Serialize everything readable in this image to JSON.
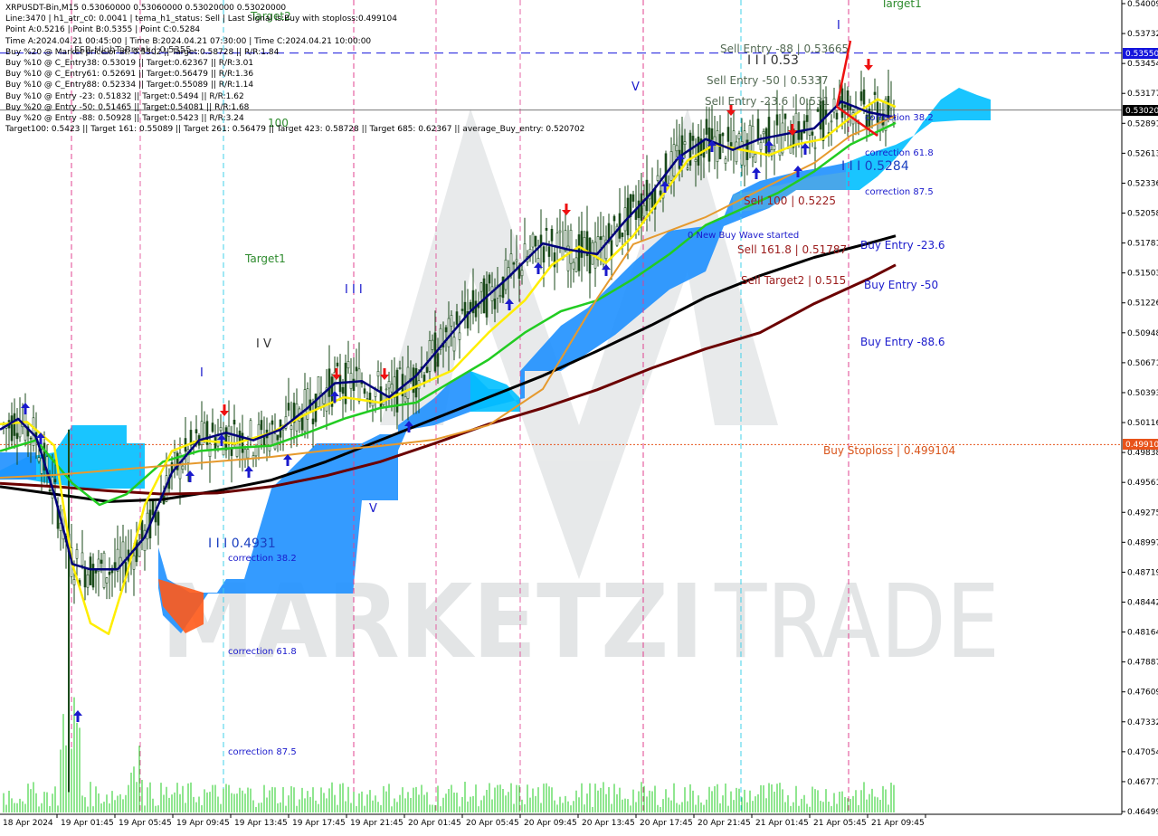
{
  "info_lines": [
    "XRPUSDT-Bin,M15  0.53060000 0.53060000 0.53020000 0.53020000",
    "Line:3470 | h1_atr_c0: 0.0041 | tema_h1_status: Sell | Last Signal is:Buy with stoploss:0.499104",
    "Point A:0.5216 | Point B:0.5355 | Point C:0.5284",
    "Time A:2024.04.21 00:45:00 | Time B:2024.04.21 07:30:00 | Time C:2024.04.21 10:00:00",
    "Buy %20 @ Market price or at: 0.5302 || Target:0.58728 || R/R:1.84",
    "Buy %10 @ C_Entry38: 0.53019 || Target:0.62367 || R/R:3.01",
    "Buy %10 @ C_Entry61: 0.52691 || Target:0.56479 || R/R:1.36",
    "Buy %10 @ C_Entry88: 0.52334 || Target:0.55089 || R/R:1.14",
    "Buy %10 @ Entry -23: 0.51832 || Target:0.5494 || R/R:1.62",
    "Buy %20 @ Entry -50: 0.51465 || Target:0.54081 || R/R:1.68",
    "Buy %20 @ Entry -88: 0.50928 || Target:0.5423 || R/R:3.24",
    "Target100: 0.5423 || Target 161: 0.55089 || Target 261: 0.56479 || Target 423: 0.58728 || Target 685: 0.62367 || average_Buy_entry: 0.520702"
  ],
  "watermark": {
    "brand_bold": "MARKETZI",
    "brand_light": "TRADE"
  },
  "price_labels": {
    "current": "0.53020",
    "blue_line": "0.53550",
    "stoploss": "0.49910"
  },
  "annotations": {
    "sell_entry_88": "Sell Entry -88 | 0.53665",
    "sell_entry_50": "Sell Entry -50 | 0.5337",
    "sell_entry_23": "Sell Entry -23.6 | 0.531",
    "sell_100": "Sell 100 | 0.5225",
    "sell_161": "Sell 161.8 | 0.51787",
    "sell_target2": "Sell Target2 | 0.515",
    "buy_entry_23": "Buy Entry -23.6",
    "buy_entry_50": "Buy Entry -50",
    "buy_entry_88": "Buy Entry -88.6",
    "buy_stoploss": "Buy Stoploss | 0.499104",
    "corr_38_right": "correction 38.2",
    "corr_61_right": "correction 61.8",
    "corr_87_right": "correction 87.5",
    "corr_38_left": "correction 38.2",
    "corr_61_left": "correction 61.8",
    "corr_87_left": "correction 87.5",
    "point_c_label": "I I I 0.5284",
    "point_b_label": "I I I 0.53",
    "low_label": "I I I 0.4931",
    "new_wave": "0 New Buy Wave started",
    "fsb_label": "FSB-HighToBreak | 0.5355",
    "target1_left": "Target1",
    "target2_left": "Target2",
    "target1_right": "Target1",
    "label_100": "100",
    "wave_V_left": "V",
    "wave_IV": "I V",
    "wave_III": "I I I",
    "wave_I": "I",
    "wave_V_top": "V",
    "wave_I_top": "I"
  },
  "colors": {
    "ema_black": "#000000",
    "ema_darkred": "#6b0000",
    "ma_green": "#22cc22",
    "ma_yellow": "#ffee00",
    "ma_navy": "#00007a",
    "ma_orange": "#e69a2e",
    "cloud_blue": "#1e90ff",
    "cloud_light": "#00bfff",
    "cloud_orange": "#ff5a1a",
    "vline_pink": "#e0408f",
    "vline_cyan": "#40d0e8",
    "candle": "#1a4a1a",
    "volume": "#22cc22"
  },
  "chart_data": {
    "type": "line",
    "title": "XRPUSDT-Bin,M15",
    "ylim": [
      0.46499,
      0.54009
    ],
    "y_ticks": [
      "0.54009",
      "0.53732",
      "0.53454",
      "0.53177",
      "0.52891",
      "0.52613",
      "0.52336",
      "0.52058",
      "0.51781",
      "0.51503",
      "0.51226",
      "0.50948",
      "0.50671",
      "0.50393",
      "0.50116",
      "0.49838",
      "0.49561",
      "0.49275",
      "0.48997",
      "0.48719",
      "0.48442",
      "0.48164",
      "0.47887",
      "0.47609",
      "0.47332",
      "0.47054",
      "0.46777",
      "0.46499"
    ],
    "x_ticks": [
      "18 Apr 2024",
      "19 Apr 01:45",
      "19 Apr 05:45",
      "19 Apr 09:45",
      "19 Apr 13:45",
      "19 Apr 17:45",
      "19 Apr 21:45",
      "20 Apr 01:45",
      "20 Apr 05:45",
      "20 Apr 09:45",
      "20 Apr 13:45",
      "20 Apr 17:45",
      "20 Apr 21:45",
      "21 Apr 01:45",
      "21 Apr 05:45",
      "21 Apr 09:45"
    ],
    "levels": {
      "current_price": 0.5302,
      "fsb_high": 0.5355,
      "buy_stoploss": 0.499104
    },
    "series": [
      {
        "color": "#000000",
        "x": [
          0,
          60,
          120,
          180,
          240,
          300,
          360,
          420,
          480,
          540,
          600,
          660,
          720,
          780,
          840,
          900,
          960,
          990
        ],
        "y": [
          0.4952,
          0.4945,
          0.4938,
          0.494,
          0.4948,
          0.4958,
          0.4975,
          0.4995,
          0.5015,
          0.5035,
          0.5055,
          0.5078,
          0.5102,
          0.5128,
          0.5148,
          0.5165,
          0.5178,
          0.5185
        ]
      },
      {
        "color": "#6b0000",
        "x": [
          0,
          60,
          120,
          180,
          240,
          300,
          360,
          420,
          480,
          540,
          600,
          660,
          720,
          780,
          840,
          900,
          960,
          990
        ],
        "y": [
          0.4955,
          0.4952,
          0.4948,
          0.4945,
          0.4946,
          0.4952,
          0.4962,
          0.4975,
          0.4992,
          0.501,
          0.5025,
          0.5042,
          0.5062,
          0.508,
          0.5095,
          0.5122,
          0.5145,
          0.5158
        ]
      },
      {
        "color": "#22cc22",
        "x": [
          0,
          40,
          80,
          110,
          140,
          180,
          220,
          260,
          300,
          340,
          380,
          420,
          460,
          500,
          540,
          580,
          620,
          660,
          700,
          740,
          780,
          820,
          860,
          900,
          940,
          990
        ],
        "y": [
          0.4985,
          0.4995,
          0.4955,
          0.4935,
          0.4945,
          0.4975,
          0.4985,
          0.4988,
          0.499,
          0.5002,
          0.5015,
          0.5025,
          0.503,
          0.505,
          0.507,
          0.5095,
          0.5115,
          0.5125,
          0.5145,
          0.5168,
          0.5195,
          0.521,
          0.5225,
          0.5245,
          0.527,
          0.529
        ]
      },
      {
        "color": "#ffee00",
        "x": [
          0,
          30,
          60,
          80,
          100,
          120,
          140,
          160,
          190,
          220,
          260,
          300,
          340,
          380,
          420,
          460,
          500,
          540,
          580,
          610,
          640,
          670,
          700,
          730,
          760,
          790,
          820,
          850,
          880,
          910,
          940,
          970,
          990
        ],
        "y": [
          0.501,
          0.5012,
          0.499,
          0.488,
          0.4825,
          0.4815,
          0.487,
          0.4935,
          0.4985,
          0.4995,
          0.4992,
          0.5002,
          0.502,
          0.5035,
          0.503,
          0.5045,
          0.506,
          0.5095,
          0.5125,
          0.5158,
          0.5175,
          0.516,
          0.5185,
          0.522,
          0.5255,
          0.527,
          0.5265,
          0.526,
          0.527,
          0.5275,
          0.5295,
          0.5312,
          0.5305
        ]
      },
      {
        "color": "#00007a",
        "x": [
          0,
          20,
          40,
          60,
          80,
          100,
          130,
          160,
          190,
          220,
          250,
          280,
          310,
          340,
          370,
          400,
          430,
          460,
          490,
          520,
          560,
          600,
          630,
          660,
          690,
          720,
          750,
          780,
          810,
          840,
          870,
          900,
          930,
          960,
          990
        ],
        "y": [
          0.5005,
          0.5015,
          0.4998,
          0.4945,
          0.488,
          0.4875,
          0.4875,
          0.4905,
          0.4965,
          0.4995,
          0.5002,
          0.4995,
          0.5005,
          0.5025,
          0.5048,
          0.505,
          0.5035,
          0.5055,
          0.5085,
          0.5115,
          0.5145,
          0.5178,
          0.5172,
          0.5168,
          0.5198,
          0.5225,
          0.5258,
          0.5275,
          0.5265,
          0.5275,
          0.528,
          0.5285,
          0.531,
          0.53,
          0.5295
        ]
      }
    ]
  }
}
